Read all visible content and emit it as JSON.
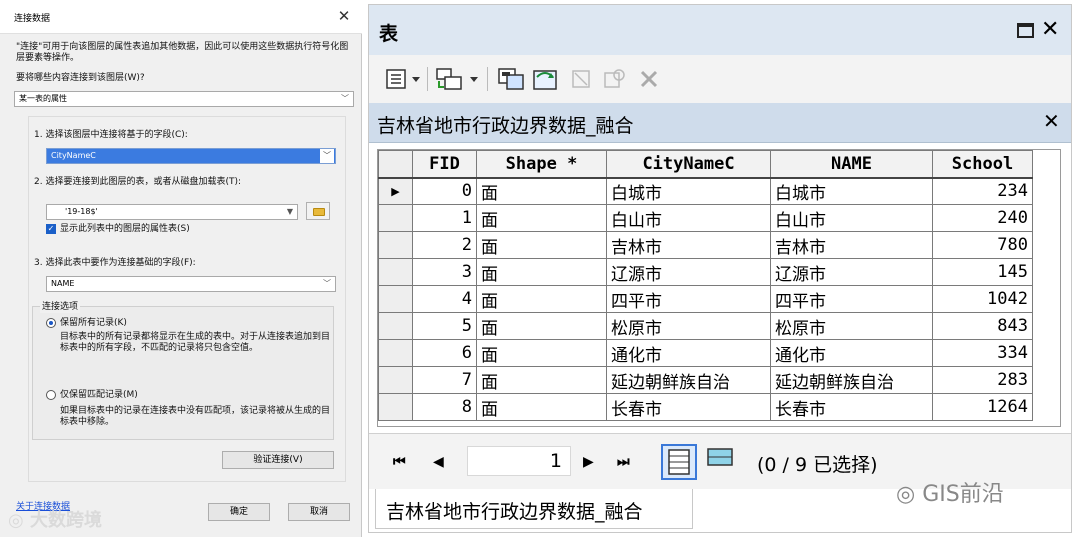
{
  "dialog": {
    "title": "连接数据",
    "close": "✕",
    "intro": "\"连接\"可用于向该图层的属性表追加其他数据，因此可以使用这些数据执行符号化图层要素等操作。",
    "what_label": "要将哪些内容连接到该图层(W)?",
    "what_value": "某一表的属性",
    "step1_label": "1. 选择该图层中连接将基于的字段(C):",
    "step1_value": "CityNameC",
    "step2_label": "2. 选择要连接到此图层的表，或者从磁盘加载表(T):",
    "step2_value": "'19-18$'",
    "show_attr_label": "显示此列表中的图层的属性表(S)",
    "step3_label": "3. 选择此表中要作为连接基础的字段(F):",
    "step3_value": "NAME",
    "options_title": "连接选项",
    "opt_keep_all_label": "保留所有记录(K)",
    "opt_keep_all_desc": "目标表中的所有记录都将显示在生成的表中。对于从连接表追加到目标表中的所有字段，不匹配的记录将只包含空值。",
    "opt_keep_match_label": "仅保留匹配记录(M)",
    "opt_keep_match_desc": "如果目标表中的记录在连接表中没有匹配项，该记录将被从生成的目标表中移除。",
    "validate_btn": "验证连接(V)",
    "about_link": "关于连接数据",
    "ok_btn": "确定",
    "cancel_btn": "取消",
    "watermark": "大数跨境"
  },
  "table_window": {
    "title": "表",
    "close": "✕",
    "table_name": "吉林省地市行政边界数据_融合",
    "tab_close": "✕",
    "columns": [
      "FID",
      "Shape *",
      "CityNameC",
      "NAME",
      "School"
    ],
    "rows": [
      {
        "fid": "0",
        "shape": "面",
        "city": "白城市",
        "name": "白城市",
        "school": "234"
      },
      {
        "fid": "1",
        "shape": "面",
        "city": "白山市",
        "name": "白山市",
        "school": "240"
      },
      {
        "fid": "2",
        "shape": "面",
        "city": "吉林市",
        "name": "吉林市",
        "school": "780"
      },
      {
        "fid": "3",
        "shape": "面",
        "city": "辽源市",
        "name": "辽源市",
        "school": "145"
      },
      {
        "fid": "4",
        "shape": "面",
        "city": "四平市",
        "name": "四平市",
        "school": "1042"
      },
      {
        "fid": "5",
        "shape": "面",
        "city": "松原市",
        "name": "松原市",
        "school": "843"
      },
      {
        "fid": "6",
        "shape": "面",
        "city": "通化市",
        "name": "通化市",
        "school": "334"
      },
      {
        "fid": "7",
        "shape": "面",
        "city": "延边朝鲜族自治",
        "name": "延边朝鲜族自治",
        "school": "283"
      },
      {
        "fid": "8",
        "shape": "面",
        "city": "长春市",
        "name": "长春市",
        "school": "1264"
      }
    ],
    "current_row_marker": "▶",
    "nav": {
      "first": "⏮",
      "prev": "◀",
      "page": "1",
      "next": "▶",
      "last": "⏭"
    },
    "status": "(0 / 9 已选择)",
    "bottom_tab": "吉林省地市行政边界数据_融合",
    "watermark": "GIS前沿"
  }
}
